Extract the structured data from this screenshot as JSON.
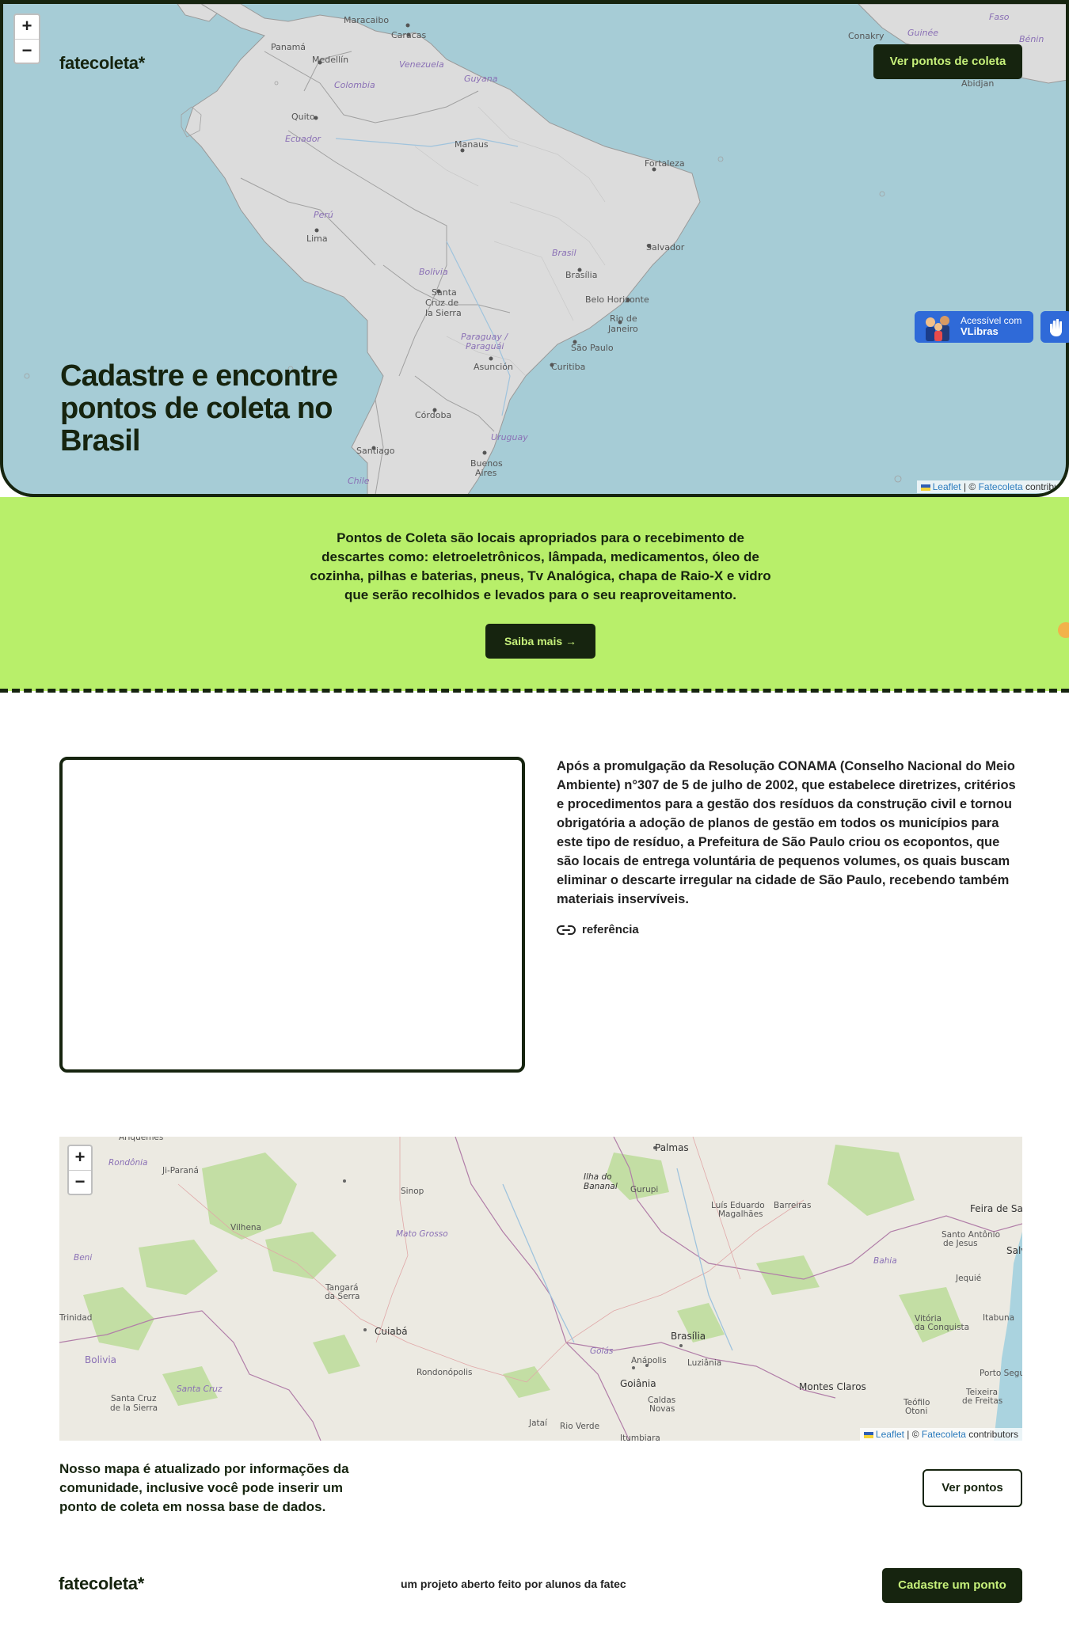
{
  "hero": {
    "brand": "fatecoleta*",
    "cta_label": "Ver pontos de coleta",
    "title": "Cadastre e encontre pontos de coleta no Brasil",
    "zoom_in": "+",
    "zoom_out": "−",
    "map_labels": [
      "Maracaibo",
      "Caracas",
      "Panamá",
      "Medellín",
      "Venezuela",
      "Colombia",
      "Guyana",
      "Quito",
      "Ecuador",
      "Manaus",
      "Fortaleza",
      "Perú",
      "Lima",
      "Brasil",
      "Salvador",
      "Bolivia",
      "Brasília",
      "Santa Cruz de la Sierra",
      "Belo Horizonte",
      "Rio de Janeiro",
      "Paraguay / Paraguái",
      "Asunción",
      "São Paulo",
      "Curitiba",
      "Córdoba",
      "Uruguay",
      "Santiago",
      "Buenos Aires",
      "Chile",
      "Conakry",
      "Guinée",
      "Bénin",
      "Abidjan",
      "Faso"
    ],
    "attribution": {
      "leaflet": "Leaflet",
      "sep": " | © ",
      "source": "Fatecoleta",
      "tail": " contribut"
    }
  },
  "vlibras": {
    "line1": "Acessível com",
    "line2": "VLibras"
  },
  "band": {
    "text": "Pontos de Coleta são locais apropriados para o recebimento de descartes como: eletroeletrônicos, lâmpada, medicamentos, óleo de cozinha, pilhas e baterias, pneus, Tv Analógica, chapa de Raio-X e vidro que serão recolhidos e levados para o seu reaproveitamento.",
    "button": "Saiba mais →"
  },
  "info": {
    "paragraph": "Após a promulgação da Resolução CONAMA (Conselho Nacional do Meio Ambiente) n°307 de 5 de julho de 2002, que estabelece diretrizes, critérios e procedimentos para a gestão dos resíduos da construção civil e tornou obrigatória a adoção de planos de gestão em todos os municípios para este tipo de resíduo, a Prefeitura de São Paulo criou os ecopontos, que são locais de entrega voluntária de pequenos volumes, os quais buscam eliminar o descarte irregular na cidade de São Paulo, recebendo também materiais inservíveis.",
    "reference": "referência"
  },
  "map2": {
    "zoom_in": "+",
    "zoom_out": "−",
    "labels": [
      "Palmas",
      "Ariquemes",
      "Rondônia",
      "Ji-Paraná",
      "Ilha do Bananal",
      "Gurupi",
      "Sinop",
      "Luís Eduardo Magalhães",
      "Barreiras",
      "Feira de San",
      "Vilhena",
      "Mato Grosso",
      "Santo Antônio de Jesus",
      "Salv",
      "Beni",
      "Bahia",
      "Jequié",
      "Tangará da Serra",
      "Trinidad",
      "Itabuna",
      "Cuiabá",
      "Brasília",
      "Vitória da Conquista",
      "Goiás",
      "Bolivia",
      "Anápolis",
      "Luziânia",
      "Rondonópolis",
      "Goiânia",
      "Porto Segu",
      "Santa Cruz",
      "Montes Claros",
      "Santa Cruz de la Sierra",
      "Caldas Novas",
      "Teixeira de Freitas",
      "Teófilo Otoni",
      "Jataí",
      "Rio Verde",
      "Itumbiara"
    ],
    "attribution": {
      "leaflet": "Leaflet",
      "sep": " | © ",
      "source": "Fatecoleta",
      "tail": " contributors"
    }
  },
  "community": {
    "text": "Nosso mapa é atualizado por informações da comunidade, inclusive você pode inserir um ponto de coleta em nossa base de dados.",
    "button": "Ver pontos"
  },
  "footer": {
    "brand": "fatecoleta*",
    "tagline": "um projeto aberto feito por alunos da fatec",
    "button": "Cadastre um ponto"
  },
  "colors": {
    "dark": "#16240f",
    "lime": "#b8ef6a",
    "lime_text": "#c6f07a",
    "ocean": "#a6ccd6",
    "land": "#dcdcdc"
  }
}
